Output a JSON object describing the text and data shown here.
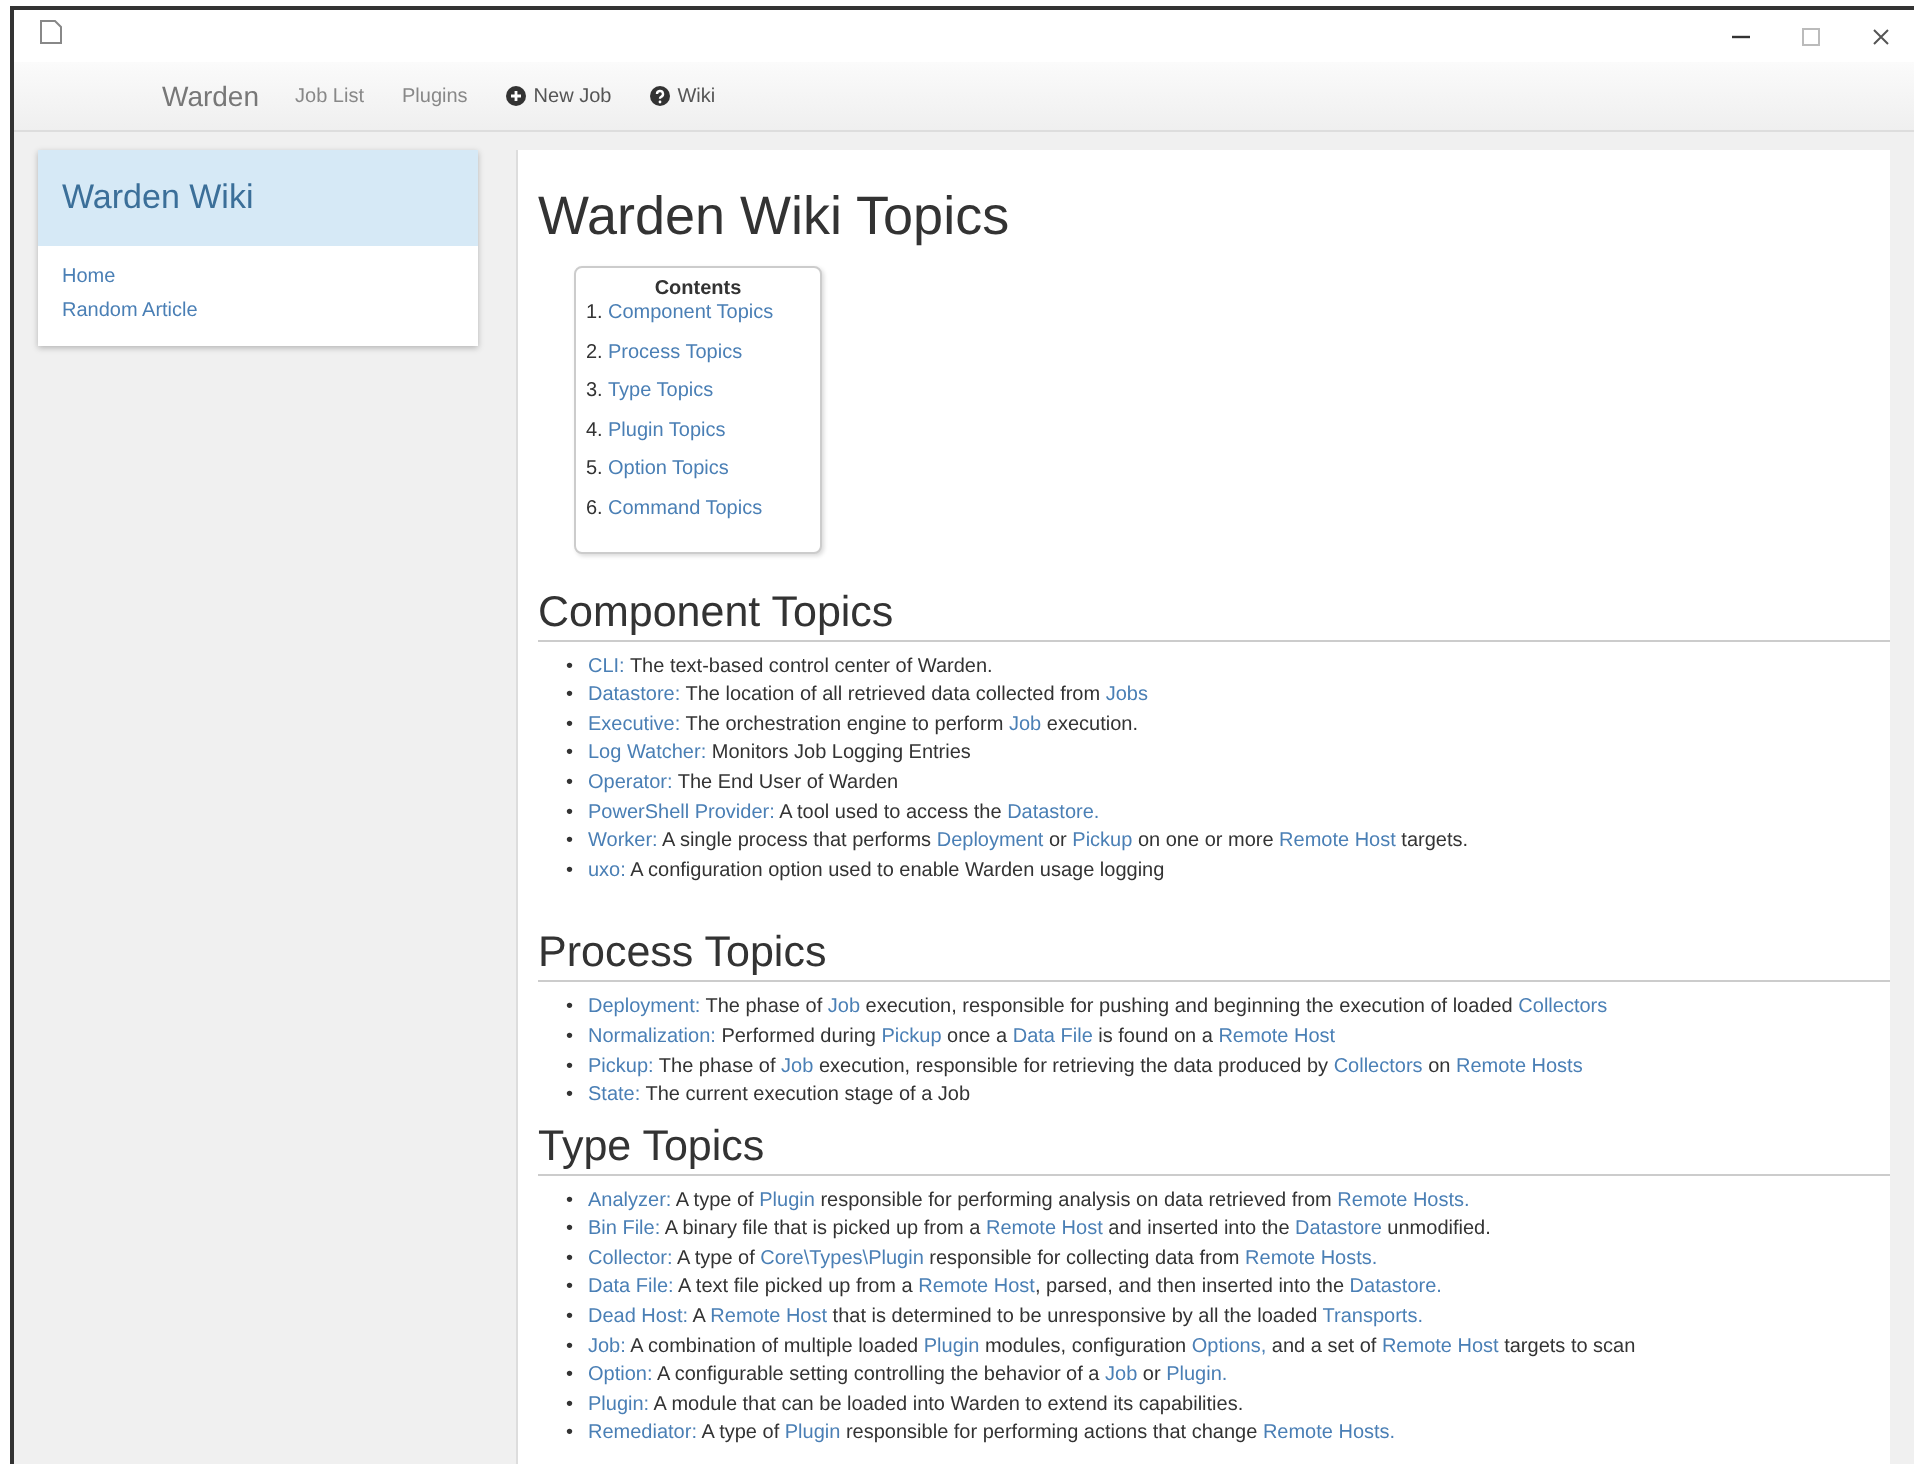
{
  "nav": {
    "brand": "Warden",
    "links": [
      {
        "label": "Job List",
        "kind": "text"
      },
      {
        "label": "Plugins",
        "kind": "text"
      },
      {
        "label": "New Job",
        "kind": "plus"
      },
      {
        "label": "Wiki",
        "kind": "help"
      }
    ]
  },
  "sidebar": {
    "title": "Warden Wiki",
    "links": [
      "Home",
      "Random Article"
    ]
  },
  "main": {
    "title": "Warden Wiki Topics",
    "contents": {
      "title": "Contents",
      "items": [
        {
          "number": "1.",
          "label": "Component Topics"
        },
        {
          "number": "2.",
          "label": "Process Topics"
        },
        {
          "number": "3.",
          "label": "Type Topics"
        },
        {
          "number": "4.",
          "label": "Plugin Topics"
        },
        {
          "number": "5.",
          "label": "Option Topics"
        },
        {
          "number": "6.",
          "label": "Command Topics"
        }
      ]
    },
    "sections": [
      {
        "heading": "Component Topics",
        "bullet": "•",
        "entries": [
          {
            "term": "CLI:",
            "parts": [
              {
                "text": " The text-based control center of Warden.",
                "link": false
              }
            ]
          },
          {
            "term": "Datastore:",
            "parts": [
              {
                "text": " The location of all retrieved data collected from ",
                "link": false
              },
              {
                "text": "Jobs",
                "link": true
              }
            ]
          },
          {
            "term": "Executive:",
            "parts": [
              {
                "text": " The orchestration engine to perform ",
                "link": false
              },
              {
                "text": "Job",
                "link": true
              },
              {
                "text": " execution.",
                "link": false
              }
            ]
          },
          {
            "term": "Log Watcher:",
            "parts": [
              {
                "text": " Monitors Job Logging Entries",
                "link": false
              }
            ]
          },
          {
            "term": "Operator:",
            "parts": [
              {
                "text": " The End User of Warden",
                "link": false
              }
            ]
          },
          {
            "term": "PowerShell Provider:",
            "parts": [
              {
                "text": " A tool used to access the ",
                "link": false
              },
              {
                "text": "Datastore.",
                "link": true
              }
            ]
          },
          {
            "term": "Worker:",
            "parts": [
              {
                "text": " A single process that performs ",
                "link": false
              },
              {
                "text": "Deployment",
                "link": true
              },
              {
                "text": " or ",
                "link": false
              },
              {
                "text": "Pickup",
                "link": true
              },
              {
                "text": " on one or more ",
                "link": false
              },
              {
                "text": "Remote Host",
                "link": true
              },
              {
                "text": " targets.",
                "link": false
              }
            ]
          },
          {
            "term": "uxo:",
            "parts": [
              {
                "text": " A configuration option used to enable Warden usage logging",
                "link": false
              }
            ]
          }
        ]
      },
      {
        "heading": "Process Topics",
        "bullet": "•",
        "entries": [
          {
            "term": "Deployment:",
            "parts": [
              {
                "text": " The phase of ",
                "link": false
              },
              {
                "text": "Job",
                "link": true
              },
              {
                "text": " execution, responsible for pushing and beginning the execution of loaded ",
                "link": false
              },
              {
                "text": "Collectors",
                "link": true
              }
            ]
          },
          {
            "term": "Normalization:",
            "parts": [
              {
                "text": " Performed during ",
                "link": false
              },
              {
                "text": "Pickup",
                "link": true
              },
              {
                "text": " once a ",
                "link": false
              },
              {
                "text": "Data File",
                "link": true
              },
              {
                "text": " is found on a ",
                "link": false
              },
              {
                "text": "Remote Host",
                "link": true
              }
            ]
          },
          {
            "term": "Pickup:",
            "parts": [
              {
                "text": " The phase of ",
                "link": false
              },
              {
                "text": "Job",
                "link": true
              },
              {
                "text": " execution, responsible for retrieving the data produced by ",
                "link": false
              },
              {
                "text": "Collectors",
                "link": true
              },
              {
                "text": " on ",
                "link": false
              },
              {
                "text": "Remote Hosts",
                "link": true
              }
            ]
          },
          {
            "term": "State:",
            "parts": [
              {
                "text": " The current execution stage of a Job",
                "link": false
              }
            ]
          }
        ]
      },
      {
        "heading": "Type Topics",
        "bullet": "•",
        "entries": [
          {
            "term": "Analyzer:",
            "parts": [
              {
                "text": " A type of ",
                "link": false
              },
              {
                "text": "Plugin",
                "link": true
              },
              {
                "text": " responsible for performing analysis on data retrieved from ",
                "link": false
              },
              {
                "text": "Remote Hosts.",
                "link": true
              }
            ]
          },
          {
            "term": "Bin File:",
            "parts": [
              {
                "text": " A binary file that is picked up from a ",
                "link": false
              },
              {
                "text": "Remote Host",
                "link": true
              },
              {
                "text": " and inserted into the ",
                "link": false
              },
              {
                "text": "Datastore",
                "link": true
              },
              {
                "text": " unmodified.",
                "link": false
              }
            ]
          },
          {
            "term": "Collector:",
            "parts": [
              {
                "text": " A type of ",
                "link": false
              },
              {
                "text": "Core\\Types\\Plugin",
                "link": true
              },
              {
                "text": " responsible for collecting data from ",
                "link": false
              },
              {
                "text": "Remote Hosts.",
                "link": true
              }
            ]
          },
          {
            "term": "Data File:",
            "parts": [
              {
                "text": " A text file picked up from a ",
                "link": false
              },
              {
                "text": "Remote Host",
                "link": true
              },
              {
                "text": ", parsed, and then inserted into the ",
                "link": false
              },
              {
                "text": "Datastore.",
                "link": true
              }
            ]
          },
          {
            "term": "Dead Host:",
            "parts": [
              {
                "text": " A ",
                "link": false
              },
              {
                "text": "Remote Host",
                "link": true
              },
              {
                "text": " that is determined to be unresponsive by all the loaded ",
                "link": false
              },
              {
                "text": "Transports.",
                "link": true
              }
            ]
          },
          {
            "term": "Job:",
            "parts": [
              {
                "text": " A combination of multiple loaded ",
                "link": false
              },
              {
                "text": "Plugin",
                "link": true
              },
              {
                "text": " modules, configuration ",
                "link": false
              },
              {
                "text": "Options,",
                "link": true
              },
              {
                "text": " and a set of ",
                "link": false
              },
              {
                "text": "Remote Host",
                "link": true
              },
              {
                "text": " targets to scan",
                "link": false
              }
            ]
          },
          {
            "term": "Option:",
            "parts": [
              {
                "text": " A configurable setting controlling the behavior of a ",
                "link": false
              },
              {
                "text": "Job",
                "link": true
              },
              {
                "text": " or ",
                "link": false
              },
              {
                "text": "Plugin.",
                "link": true
              }
            ]
          },
          {
            "term": "Plugin:",
            "parts": [
              {
                "text": " A module that can be loaded into Warden to extend its capabilities.",
                "link": false
              }
            ]
          },
          {
            "term": "Remediator:",
            "parts": [
              {
                "text": " A type of ",
                "link": false
              },
              {
                "text": "Plugin",
                "link": true
              },
              {
                "text": " responsible for performing actions that change ",
                "link": false
              },
              {
                "text": "Remote Hosts.",
                "link": true
              }
            ]
          }
        ]
      }
    ]
  }
}
